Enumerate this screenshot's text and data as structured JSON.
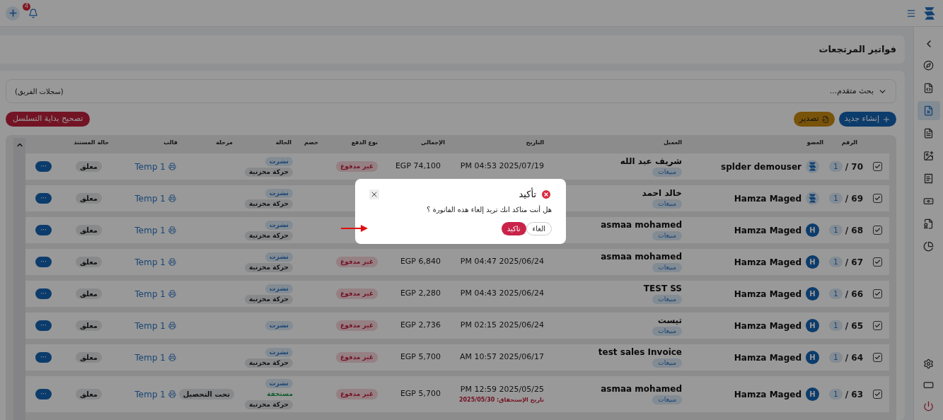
{
  "topbar": {
    "notifications": "4"
  },
  "sidebar": {
    "items": [
      {
        "selected": false
      },
      {
        "selected": false
      },
      {
        "selected": true
      },
      {
        "selected": false
      },
      {
        "selected": false
      },
      {
        "selected": false
      },
      {
        "selected": false
      },
      {
        "selected": false
      },
      {
        "selected": false
      }
    ]
  },
  "page_title": "فواتير المرتجعات",
  "filter": {
    "label": "بحث متقدم...",
    "scope": "(سجلات الفريق)"
  },
  "actions": {
    "create": "إنشاء جديد",
    "export": "تصدير",
    "fix_sequence": "تصحيح بداية التسلسل"
  },
  "table": {
    "columns": [
      "الرقم",
      "العضو",
      "العميل",
      "التاريخ",
      "الإجمالي",
      "نوع الدفع",
      "خصم",
      "الحالة",
      "مرحلة",
      "قالب",
      "حالة المستند"
    ],
    "rows": [
      {
        "checked": true,
        "number": "70 /",
        "version": "1",
        "member": "splder demouser",
        "avatar": {
          "kind": "logo"
        },
        "client": "شريف عبد الله",
        "client_tag": "مبيعات",
        "date": "PM 04:53 2025/07/19",
        "total": "EGP 74,100",
        "payment": "غير مدفوع",
        "statuses": [
          {
            "kind": "published",
            "text": "نشرت"
          },
          {
            "kind": "stock",
            "text": "حركة مخزنية"
          }
        ],
        "template": "Temp 1",
        "doc_status": "معلق",
        "menu": "···"
      },
      {
        "checked": true,
        "number": "69 /",
        "version": "1",
        "member": "Hamza Maged",
        "avatar": {
          "kind": "logo"
        },
        "client": "خالد احمد",
        "client_tag": "مبيعات",
        "statuses": [
          {
            "kind": "published",
            "text": "نشرت"
          },
          {
            "kind": "stock",
            "text": "حركة مخزنية"
          }
        ],
        "template": "Temp 1",
        "doc_status": "معلق",
        "menu": "···"
      },
      {
        "checked": true,
        "number": "68 /",
        "version": "1",
        "member": "Hamza Maged",
        "avatar": {
          "kind": "letter",
          "text": "H"
        },
        "client": "asmaa mohamed",
        "client_tag": "مبيعات",
        "statuses": [
          {
            "kind": "published",
            "text": "نشرت"
          },
          {
            "kind": "stock",
            "text": "حركة مخزنية"
          }
        ],
        "template": "Temp 1",
        "doc_status": "معلق",
        "menu": "···"
      },
      {
        "checked": true,
        "number": "67 /",
        "version": "1",
        "member": "Hamza Maged",
        "avatar": {
          "kind": "letter",
          "text": "H"
        },
        "client": "asmaa mohamed",
        "client_tag": "مبيعات",
        "date": "PM 04:47 2025/06/24",
        "total": "EGP 6,840",
        "payment": "غير مدفوع",
        "statuses": [
          {
            "kind": "published",
            "text": "نشرت"
          },
          {
            "kind": "stock",
            "text": "حركة مخزنية"
          }
        ],
        "template": "Temp 1",
        "doc_status": "معلق",
        "menu": "···"
      },
      {
        "checked": true,
        "number": "66 /",
        "version": "1",
        "member": "Hamza Maged",
        "avatar": {
          "kind": "letter",
          "text": "H"
        },
        "client": "TEST SS",
        "client_tag": "مبيعات",
        "date": "PM 04:43 2025/06/24",
        "total": "EGP 2,280",
        "payment": "غير مدفوع",
        "statuses": [
          {
            "kind": "published",
            "text": "نشرت"
          },
          {
            "kind": "stock",
            "text": "حركة مخزنية"
          }
        ],
        "template": "Temp 1",
        "doc_status": "معلق",
        "menu": "···"
      },
      {
        "checked": true,
        "number": "65 /",
        "version": "1",
        "member": "Hamza Maged",
        "avatar": {
          "kind": "letter",
          "text": "H"
        },
        "client": "تيست",
        "client_tag": "مبيعات",
        "date": "PM 02:15 2025/06/24",
        "total": "EGP 2,736",
        "payment": "غير مدفوع",
        "statuses": [
          {
            "kind": "published",
            "text": "نشرت"
          }
        ],
        "template": "Temp 1",
        "doc_status": "معلق",
        "menu": "···"
      },
      {
        "checked": true,
        "number": "64 /",
        "version": "1",
        "member": "Hamza Maged",
        "avatar": {
          "kind": "letter",
          "text": "H"
        },
        "client": "test sales Invoice",
        "client_tag": "مبيعات",
        "date": "AM 10:57 2025/06/17",
        "total": "EGP 5,700",
        "payment": "غير مدفوع",
        "statuses": [
          {
            "kind": "published",
            "text": "نشرت"
          },
          {
            "kind": "stock",
            "text": "حركة مخزنية"
          }
        ],
        "template": "Temp 1",
        "doc_status": "معلق",
        "menu": "···"
      },
      {
        "checked": true,
        "number": "63 /",
        "version": "1",
        "member": "Hamza Maged",
        "avatar": {
          "kind": "letter",
          "text": "H"
        },
        "client": "asmaa mohamed",
        "client_tag": "مبيعات",
        "date": "PM 12:59 2025/05/25",
        "due_date": "تاريخ الإستحقاق: 2025/05/30",
        "total": "EGP 5,700",
        "payment": "غير مدفوع",
        "statuses": [
          {
            "kind": "published",
            "text": "نشرت"
          },
          {
            "kind": "due",
            "text": "مستحقة"
          },
          {
            "kind": "stock",
            "text": "حركة مخزنية"
          }
        ],
        "stage": "تحت التحصيل",
        "template": "Temp 1",
        "doc_status": "معلق",
        "menu": "···"
      }
    ]
  },
  "dialog": {
    "title": "تأكيد",
    "message": "هل أنت متاكد انك تريد إلغاء هذه الفاتورة ؟",
    "cancel": "الغاء",
    "confirm": "تاكيد"
  }
}
